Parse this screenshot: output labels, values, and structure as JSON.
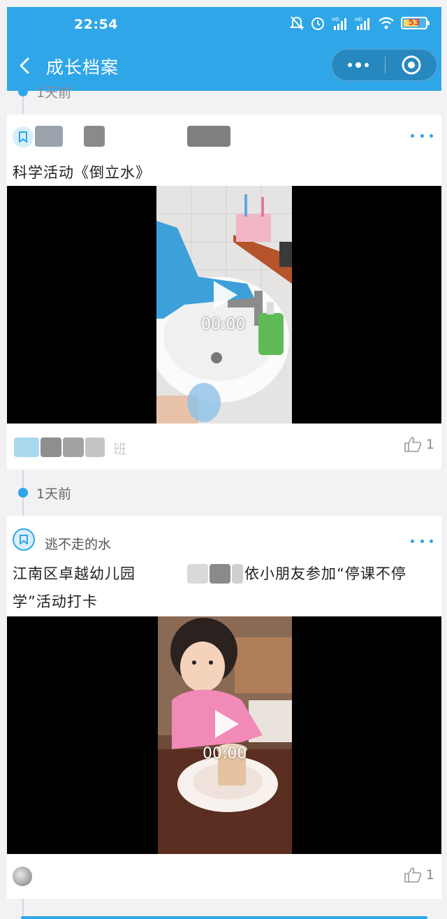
{
  "status_bar": {
    "time": "22:54",
    "battery_level": "53"
  },
  "nav": {
    "title": "成长档案"
  },
  "timeline": {
    "top_label": "1天前",
    "middle_label": "1天前"
  },
  "post1": {
    "title": "科学活动《倒立水》",
    "video_time": "00:00",
    "footer_class_suffix": "班",
    "likes": "1"
  },
  "post2": {
    "tag_label": "逃不走的水",
    "title_line1_part1": "江南区卓越幼儿园",
    "title_line1_part2": "依小朋友参加“停课不停",
    "title_line2": "学”活动打卡",
    "video_time": "00:00",
    "likes": "1"
  },
  "colors": {
    "accent": "#2fa6e8",
    "background": "#f2f2f4"
  }
}
